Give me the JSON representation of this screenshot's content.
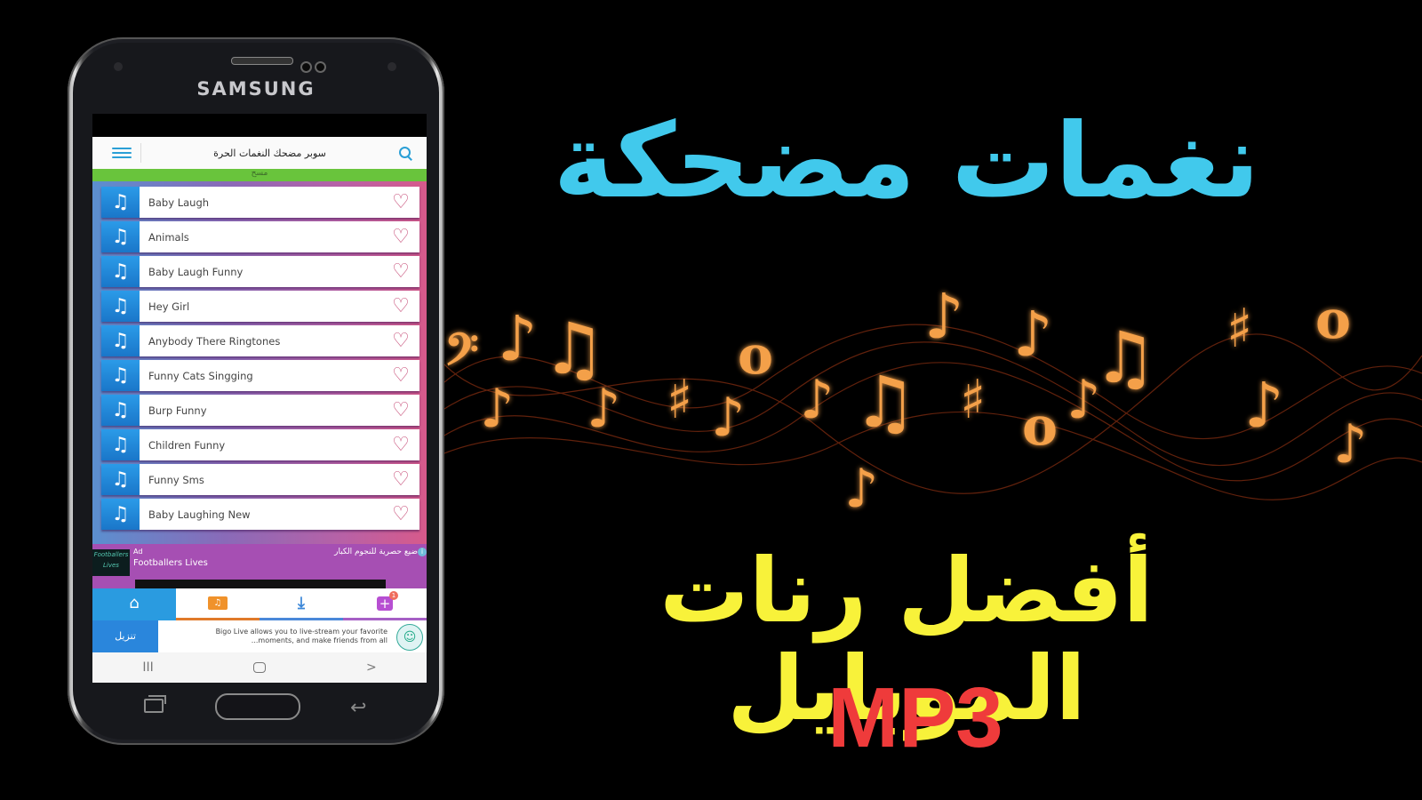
{
  "phone": {
    "brand": "SAMSUNG",
    "app": {
      "title": "سوبر مضحك النغمات الحرة",
      "subtitle": "مسح",
      "ringtones": [
        {
          "label": "Baby Laugh"
        },
        {
          "label": "Animals"
        },
        {
          "label": "Baby Laugh Funny"
        },
        {
          "label": "Hey Girl"
        },
        {
          "label": "Anybody There Ringtones"
        },
        {
          "label": "Funny Cats Singging"
        },
        {
          "label": "Burp Funny"
        },
        {
          "label": "Children Funny"
        },
        {
          "label": "Funny Sms"
        },
        {
          "label": "Baby Laughing New"
        }
      ],
      "ad": {
        "tag": "Ad",
        "title": "Footballers Lives",
        "arabic": "ضيع حصرية للنجوم الكبار",
        "thumb_text": "Footballers Lives",
        "info": "i"
      },
      "tabs": [
        {
          "name": "home",
          "icon": "⌂"
        },
        {
          "name": "my-ringtones",
          "icon": "♫"
        },
        {
          "name": "downloads",
          "icon": "⤓"
        },
        {
          "name": "add",
          "icon": "+",
          "badge": "1"
        }
      ],
      "banner": {
        "install_label": "تنزيل",
        "text": "Bigo Live allows you to live-stream your favorite ...moments, and make friends from all"
      },
      "nav": {
        "recents": "III",
        "back": ">"
      }
    }
  },
  "headline": {
    "top": "نغمات مضحكة",
    "middle": "أفضل رنات الموبايل",
    "bottom": "MP3"
  },
  "colors": {
    "headline_top": "#41c9ec",
    "headline_middle": "#f8f23a",
    "headline_bottom": "#ef3b3b",
    "accent_blue": "#2a9be0",
    "green_bar": "#69c43c"
  }
}
